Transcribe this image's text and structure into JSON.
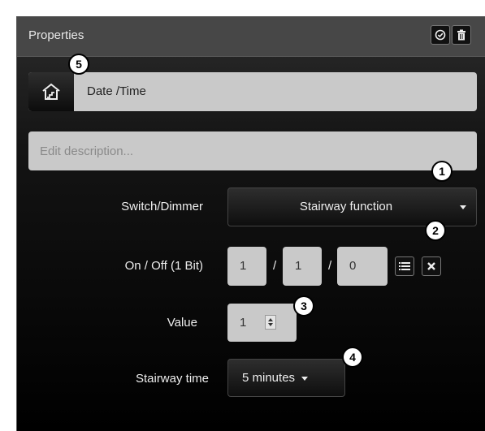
{
  "header": {
    "title": "Properties",
    "confirm_icon": "check-circle-icon",
    "delete_icon": "trash-icon"
  },
  "name_row": {
    "icon": "stairway-home-icon",
    "name": "Date /Time"
  },
  "description": {
    "placeholder": "Edit description...",
    "value": ""
  },
  "switch_dimmer": {
    "label": "Switch/Dimmer",
    "selected": "Stairway function"
  },
  "on_off": {
    "label": "On / Off (1 Bit)",
    "main_group": "1",
    "middle_group": "1",
    "sub_group": "0",
    "separator": "/",
    "list_icon": "list-icon",
    "clear_icon": "close-icon"
  },
  "value": {
    "label": "Value",
    "number": "1"
  },
  "stairway_time": {
    "label": "Stairway time",
    "selected": "5 minutes"
  },
  "callouts": [
    "1",
    "2",
    "3",
    "4",
    "5"
  ],
  "colors": {
    "panel_bg": "#000000",
    "header_bg": "#474747",
    "field_bg": "#c9c9c9",
    "text": "#eeeeee"
  }
}
